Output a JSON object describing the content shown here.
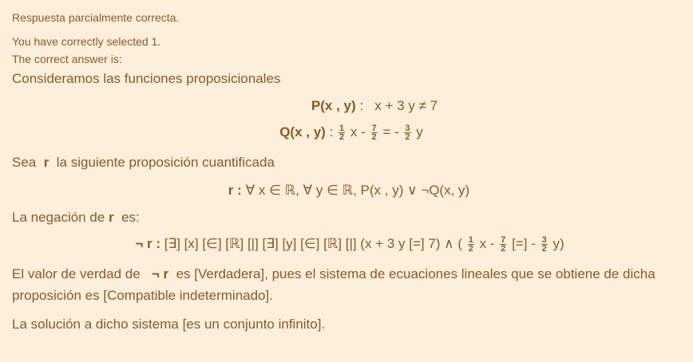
{
  "feedback": {
    "status": "Respuesta parcialmente correcta.",
    "selected": "You have correctly selected 1.",
    "correct_intro": "The correct answer is:"
  },
  "question": {
    "intro": "Consideramos las funciones proposicionales",
    "p_label": "P(x , y)",
    "p_sep": ":",
    "p_expr": "x + 3 y ≠ 7",
    "q_label": "Q(x , y)",
    "q_sep": ":",
    "q_f1_num": "1",
    "q_f1_den": "2",
    "q_x_minus": "x -",
    "q_f2_num": "7",
    "q_f2_den": "2",
    "q_eq": "= -",
    "q_f3_num": "3",
    "q_f3_den": "2",
    "q_y": "y",
    "sea_prefix": "Sea",
    "sea_r": "r",
    "sea_suffix": "la siguiente proposición cuantificada",
    "r_label": "r :",
    "r_expr": "∀ x ∈ ℝ, ∀ y ∈ ℝ, P(x , y) ∨ ¬Q(x, y)",
    "neg_prefix": "La negación de",
    "neg_r": "r",
    "neg_suffix": "es:",
    "nr_label": "¬ r :",
    "nr_expr1": "[∃] [x] [∈] [ℝ] [|] [∃] [y] [∈] [ℝ] [|] (x + 3 y [=] 7) ∧ (",
    "nr_f1_num": "1",
    "nr_f1_den": "2",
    "nr_x_minus": "x -",
    "nr_f2_num": "7",
    "nr_f2_den": "2",
    "nr_eq": "[=] -",
    "nr_f3_num": "3",
    "nr_f3_den": "2",
    "nr_y": "y)",
    "truth_prefix": "El valor de verdad de",
    "truth_nr": "¬ r",
    "truth_mid": "es  [Verdadera],  pues el sistema de ecuaciones lineales que se obtiene de dicha proposición es [Compatible indeterminado].",
    "solution": "La solución a dicho sistema [es un conjunto infinito]."
  },
  "colors": {
    "background": "#fcefdc",
    "text": "#8a5a26"
  }
}
